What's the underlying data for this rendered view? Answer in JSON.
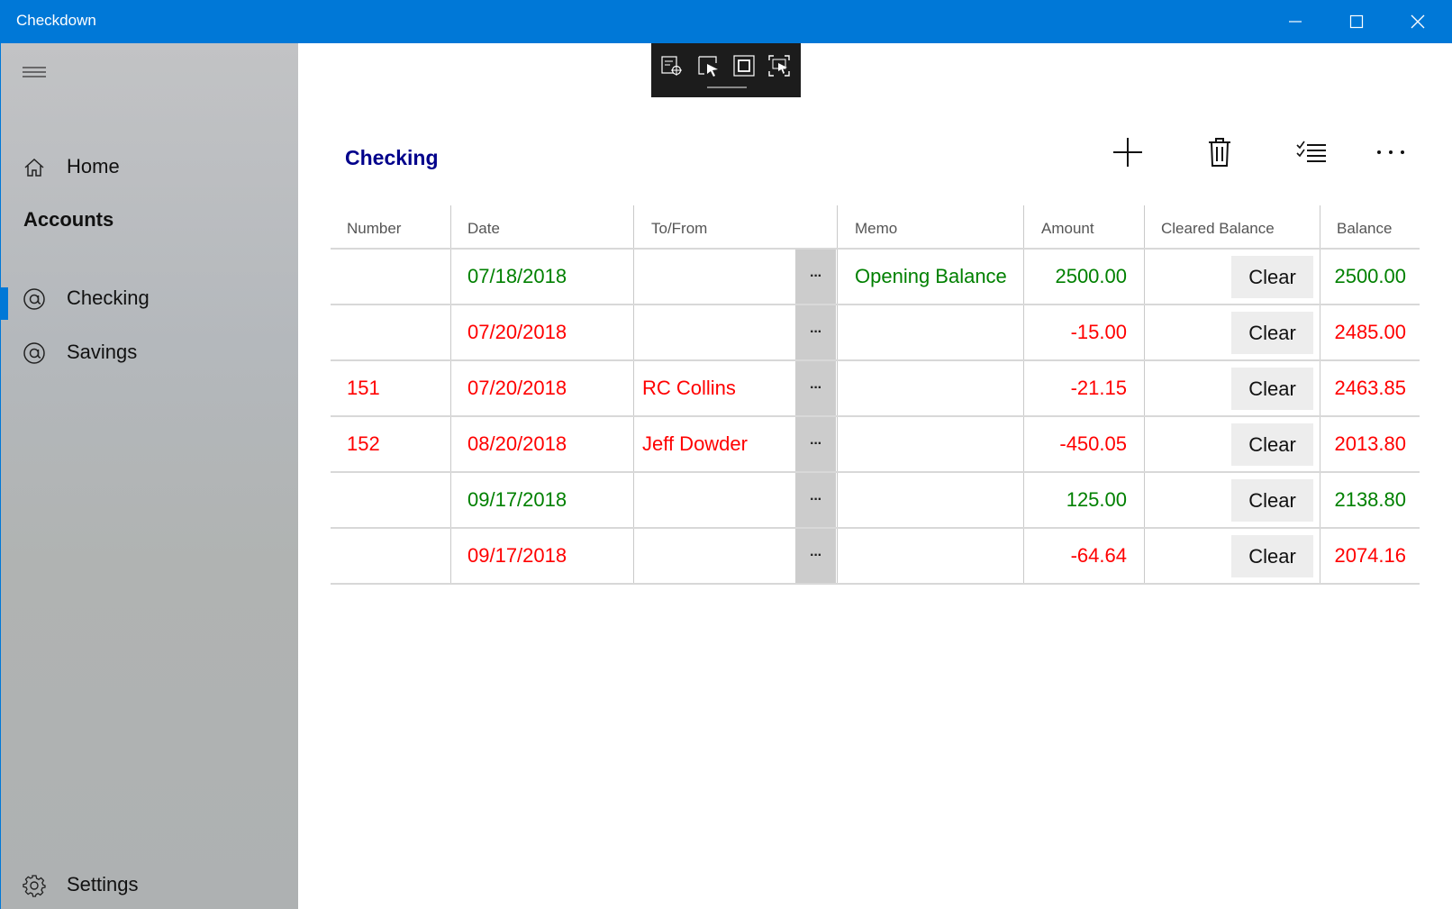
{
  "window": {
    "title": "Checkdown"
  },
  "sidebar": {
    "home_label": "Home",
    "section_label": "Accounts",
    "accounts": [
      {
        "label": "Checking",
        "icon": "at-icon",
        "selected": true
      },
      {
        "label": "Savings",
        "icon": "at-icon",
        "selected": false
      }
    ],
    "settings_label": "Settings"
  },
  "page": {
    "title": "Checking",
    "commands": [
      "add-icon",
      "delete-icon",
      "checklist-icon",
      "more-icon"
    ]
  },
  "table": {
    "columns": [
      "Number",
      "Date",
      "To/From",
      "Memo",
      "Amount",
      "Cleared Balance",
      "Balance"
    ],
    "rows": [
      {
        "number": "",
        "date": "07/18/2018",
        "tofrom": "",
        "memo": "Opening Balance",
        "amount": "2500.00",
        "clear": "Clear",
        "balance": "2500.00",
        "status": "credit"
      },
      {
        "number": "",
        "date": "07/20/2018",
        "tofrom": "",
        "memo": "",
        "amount": "-15.00",
        "clear": "Clear",
        "balance": "2485.00",
        "status": "debit"
      },
      {
        "number": "151",
        "date": "07/20/2018",
        "tofrom": "RC Collins",
        "memo": "",
        "amount": "-21.15",
        "clear": "Clear",
        "balance": "2463.85",
        "status": "debit"
      },
      {
        "number": "152",
        "date": "08/20/2018",
        "tofrom": "Jeff Dowder",
        "memo": "",
        "amount": "-450.05",
        "clear": "Clear",
        "balance": "2013.80",
        "status": "debit"
      },
      {
        "number": "",
        "date": "09/17/2018",
        "tofrom": "",
        "memo": "",
        "amount": "125.00",
        "clear": "Clear",
        "balance": "2138.80",
        "status": "credit"
      },
      {
        "number": "",
        "date": "09/17/2018",
        "tofrom": "",
        "memo": "",
        "amount": "-64.64",
        "clear": "Clear",
        "balance": "2074.16",
        "status": "debit"
      }
    ],
    "row_menu_label": "···"
  },
  "colors": {
    "accent": "#0078d7",
    "credit": "#008000",
    "debit": "#ff0000",
    "title": "#00008b"
  }
}
